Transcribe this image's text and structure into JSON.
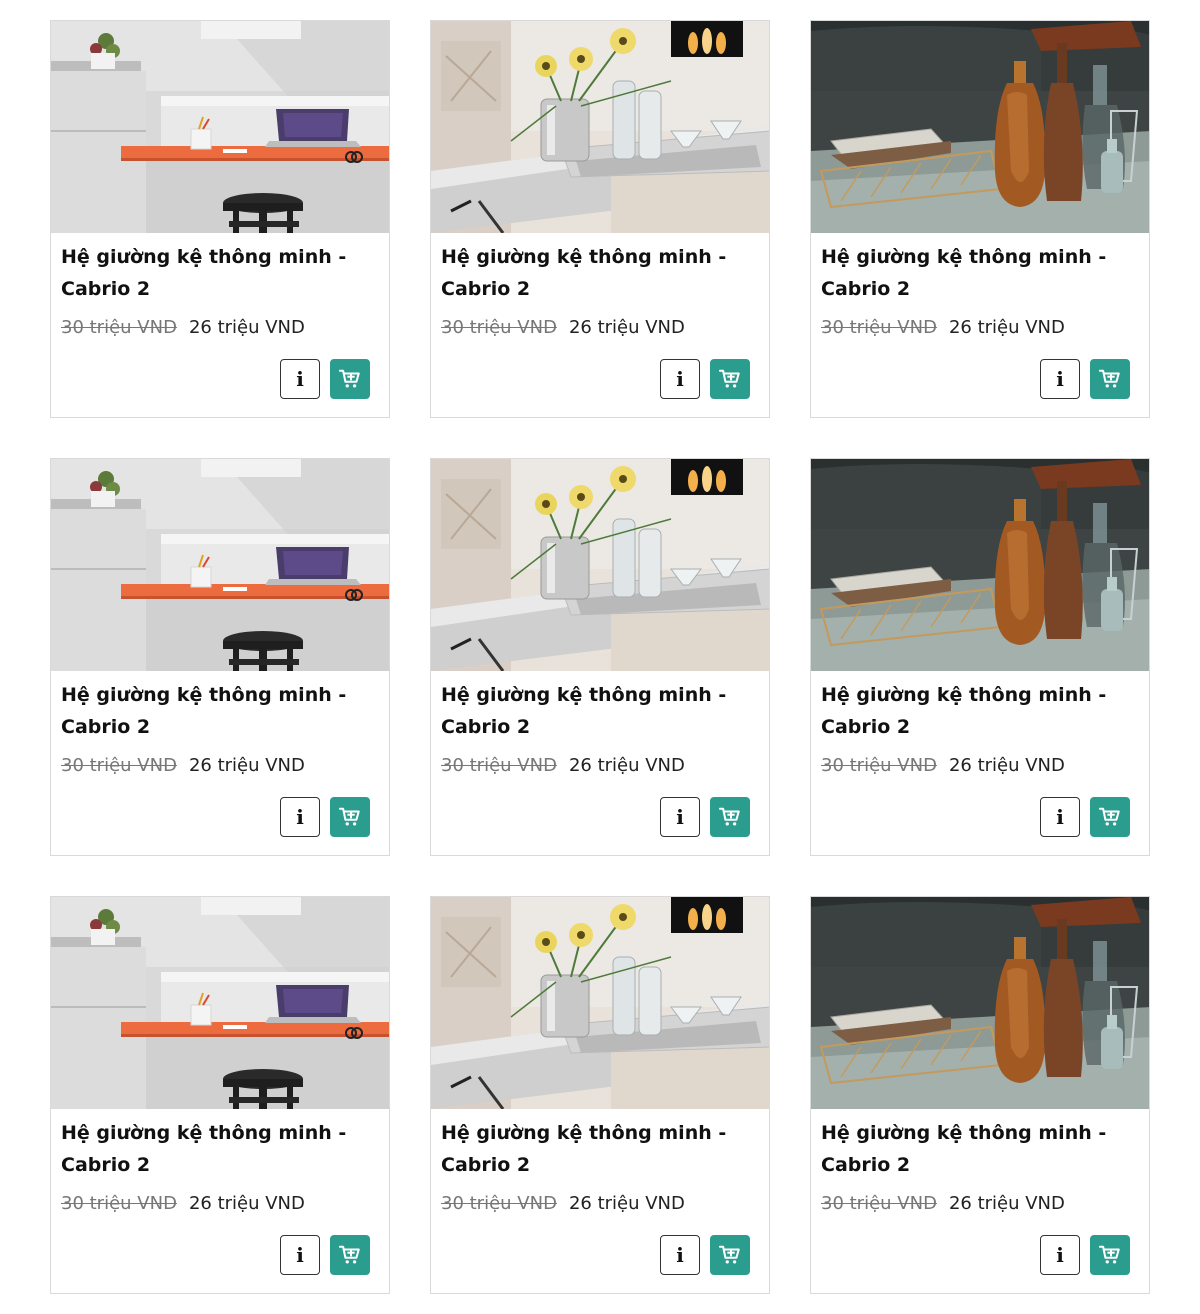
{
  "products": [
    {
      "scene": "desk",
      "title": "Hệ giường kệ thông minh - Cabrio 2",
      "old_price": "30 triệu VND",
      "new_price": "26 triệu VND"
    },
    {
      "scene": "vase",
      "title": "Hệ giường kệ thông minh - Cabrio 2",
      "old_price": "30 triệu VND",
      "new_price": "26 triệu VND"
    },
    {
      "scene": "sofa",
      "title": "Hệ giường kệ thông minh - Cabrio 2",
      "old_price": "30 triệu VND",
      "new_price": "26 triệu VND"
    },
    {
      "scene": "desk",
      "title": "Hệ giường kệ thông minh - Cabrio 2",
      "old_price": "30 triệu VND",
      "new_price": "26 triệu VND"
    },
    {
      "scene": "vase",
      "title": "Hệ giường kệ thông minh - Cabrio 2",
      "old_price": "30 triệu VND",
      "new_price": "26 triệu VND"
    },
    {
      "scene": "sofa",
      "title": "Hệ giường kệ thông minh - Cabrio 2",
      "old_price": "30 triệu VND",
      "new_price": "26 triệu VND"
    },
    {
      "scene": "desk",
      "title": "Hệ giường kệ thông minh - Cabrio 2",
      "old_price": "30 triệu VND",
      "new_price": "26 triệu VND"
    },
    {
      "scene": "vase",
      "title": "Hệ giường kệ thông minh - Cabrio 2",
      "old_price": "30 triệu VND",
      "new_price": "26 triệu VND"
    },
    {
      "scene": "sofa",
      "title": "Hệ giường kệ thông minh - Cabrio 2",
      "old_price": "30 triệu VND",
      "new_price": "26 triệu VND"
    }
  ],
  "buttons": {
    "info_glyph": "i",
    "info_icon": "info-icon",
    "cart_icon": "add-to-cart-icon"
  },
  "colors": {
    "cart_button": "#2a9d8f",
    "old_price": "#777777",
    "border": "#d9d9d9"
  }
}
